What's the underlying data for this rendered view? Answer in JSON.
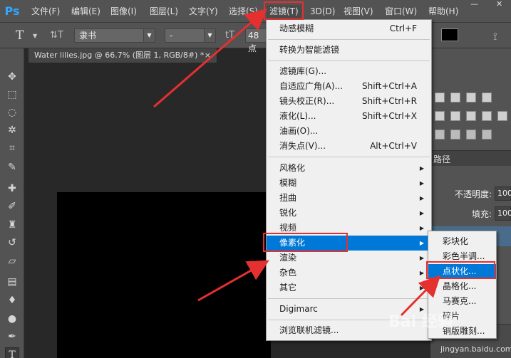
{
  "app": {
    "logo": "Ps"
  },
  "menubar": {
    "items": [
      "文件(F)",
      "编辑(E)",
      "图像(I)",
      "图层(L)",
      "文字(Y)",
      "选择(S)",
      "滤镜(T)",
      "3D(D)",
      "视图(V)",
      "窗口(W)",
      "帮助(H)"
    ],
    "active_index": 6
  },
  "window_controls": {
    "minimize": "—",
    "close": "✕"
  },
  "options": {
    "tool_glyph": "T",
    "orient_glyph": "⇅T",
    "font_family": "隶书",
    "font_style": "-",
    "size_glyph": "tT",
    "font_size": "48 点",
    "warp_glyph": "⟟"
  },
  "document_tab": {
    "title": "Water lilies.jpg @ 66.7% (图层 1, RGB/8#) *",
    "close": "×"
  },
  "filter_menu": {
    "top": {
      "label": "动感模糊",
      "shortcut": "Ctrl+F"
    },
    "smart": "转换为智能滤镜",
    "group1": [
      {
        "label": "滤镜库(G)...",
        "shortcut": ""
      },
      {
        "label": "自适应广角(A)...",
        "shortcut": "Shift+Ctrl+A"
      },
      {
        "label": "镜头校正(R)...",
        "shortcut": "Shift+Ctrl+R"
      },
      {
        "label": "液化(L)...",
        "shortcut": "Shift+Ctrl+X"
      },
      {
        "label": "油画(O)...",
        "shortcut": ""
      },
      {
        "label": "消失点(V)...",
        "shortcut": "Alt+Ctrl+V"
      }
    ],
    "submenus": [
      "风格化",
      "模糊",
      "扭曲",
      "锐化",
      "视频",
      "像素化",
      "渲染",
      "杂色",
      "其它"
    ],
    "highlighted_submenu": "像素化",
    "digimarc": "Digimarc",
    "browse": "浏览联机滤镜..."
  },
  "pixelate_submenu": {
    "items": [
      "彩块化",
      "彩色半调...",
      "点状化...",
      "晶格化...",
      "马赛克...",
      "碎片",
      "铜版雕刻..."
    ],
    "highlighted": "点状化..."
  },
  "right_panel": {
    "tab_label": "路径",
    "opacity_label": "不透明度:",
    "opacity_value": "100",
    "fill_label": "填充:",
    "fill_value": "100"
  },
  "watermark": {
    "brand": "Bai 经验",
    "url": "jingyan.baidu.com"
  },
  "colors": {
    "highlight": "#0078d7",
    "annotation": "#e53030",
    "ps_blue": "#31a8ff"
  }
}
